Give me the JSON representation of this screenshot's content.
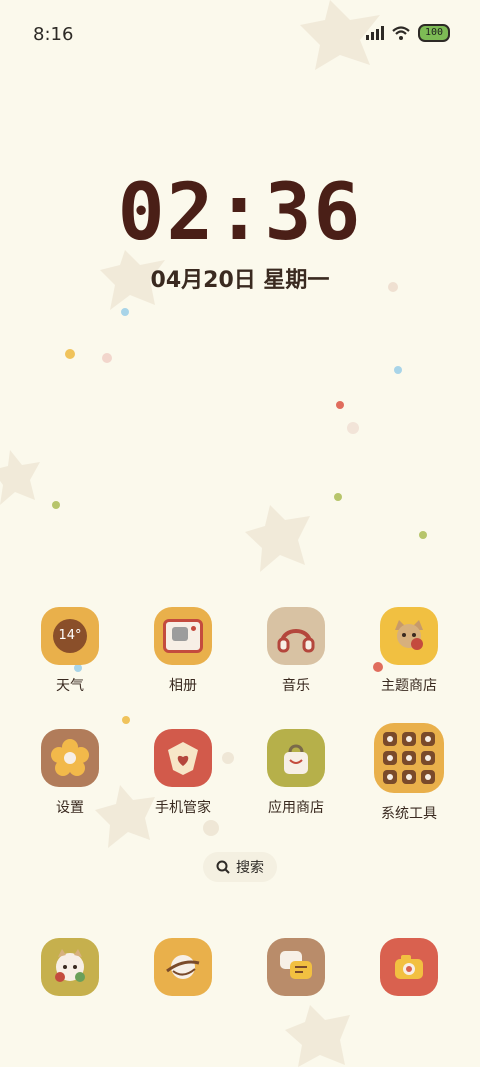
{
  "status": {
    "time": "8:16",
    "battery": "100"
  },
  "clock": {
    "time": "02:36",
    "date": "04月20日 星期一"
  },
  "apps_row1": [
    {
      "label": "天气",
      "badge": "14°",
      "color": "#e9b04b"
    },
    {
      "label": "相册",
      "color": "#e9b04b"
    },
    {
      "label": "音乐",
      "color": "#d8c2a3"
    },
    {
      "label": "主题商店",
      "color": "#f1c041"
    }
  ],
  "apps_row2": [
    {
      "label": "设置",
      "color": "#b17c5a"
    },
    {
      "label": "手机管家",
      "color": "#d25a4b"
    },
    {
      "label": "应用商店",
      "color": "#b6b04a"
    },
    {
      "label": "系统工具",
      "color": "#e9b04b"
    }
  ],
  "search": {
    "label": "搜索"
  },
  "dock": [
    {
      "name": "dock-app-1",
      "color": "#c6b04d"
    },
    {
      "name": "dock-app-2",
      "color": "#e9b04b"
    },
    {
      "name": "dock-app-3",
      "color": "#b98c6a"
    },
    {
      "name": "dock-app-4",
      "color": "#d9614f"
    }
  ]
}
